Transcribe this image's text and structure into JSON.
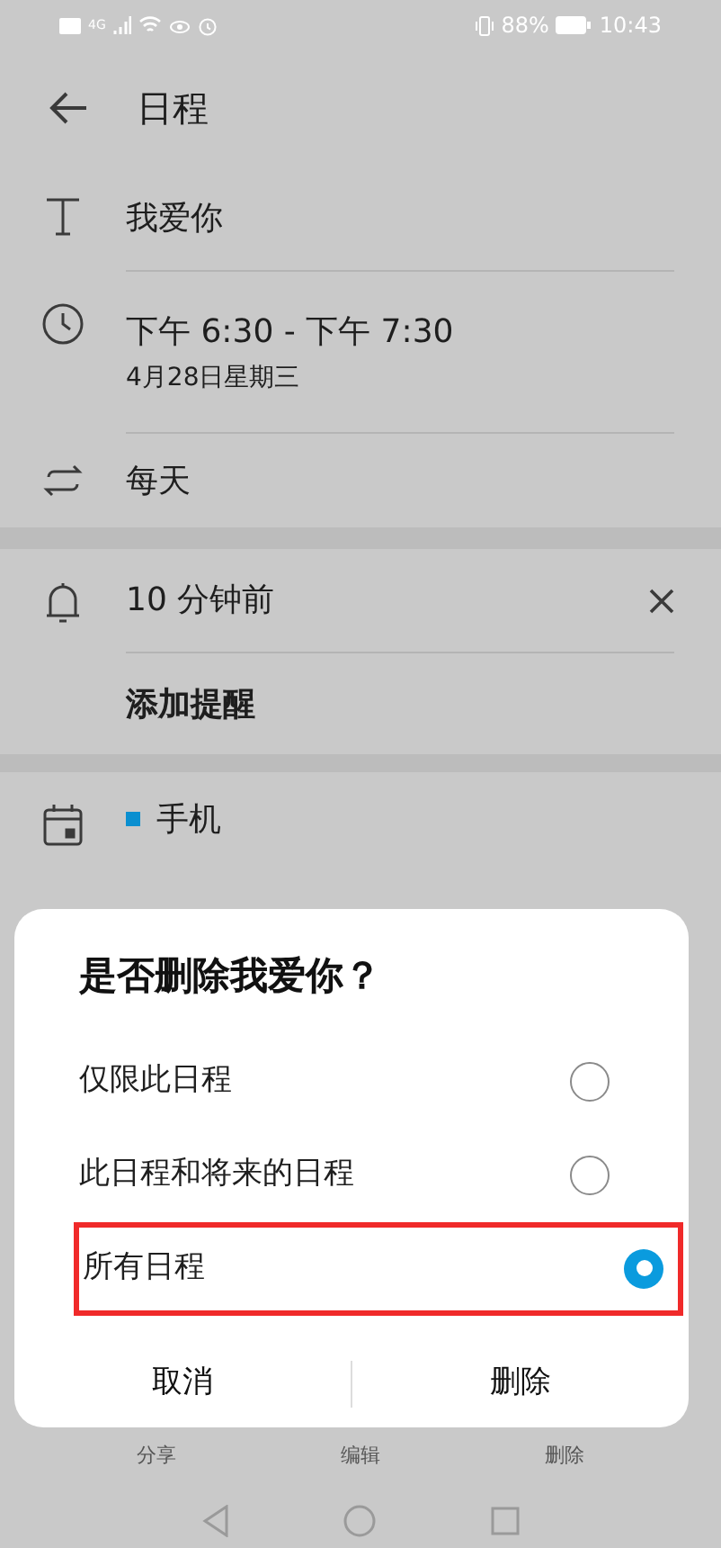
{
  "status_bar": {
    "network": "4G",
    "battery": "88%",
    "time": "10:43"
  },
  "header": {
    "title": "日程"
  },
  "event": {
    "title": "我爱你",
    "time": "下午 6:30 - 下午 7:30",
    "date": "4月28日星期三",
    "repeat": "每天",
    "reminder": "10 分钟前",
    "add_reminder": "添加提醒",
    "calendar": {
      "name": "手机",
      "color": "#0a8fd0"
    }
  },
  "dialog": {
    "title": "是否删除我爱你？",
    "options": [
      {
        "label": "仅限此日程",
        "selected": false,
        "highlighted": false
      },
      {
        "label": "此日程和将来的日程",
        "selected": false,
        "highlighted": false
      },
      {
        "label": "所有日程",
        "selected": true,
        "highlighted": true
      }
    ],
    "buttons": [
      "取消",
      "删除"
    ]
  },
  "toolbar": [
    "分享",
    "编辑",
    "删除"
  ]
}
